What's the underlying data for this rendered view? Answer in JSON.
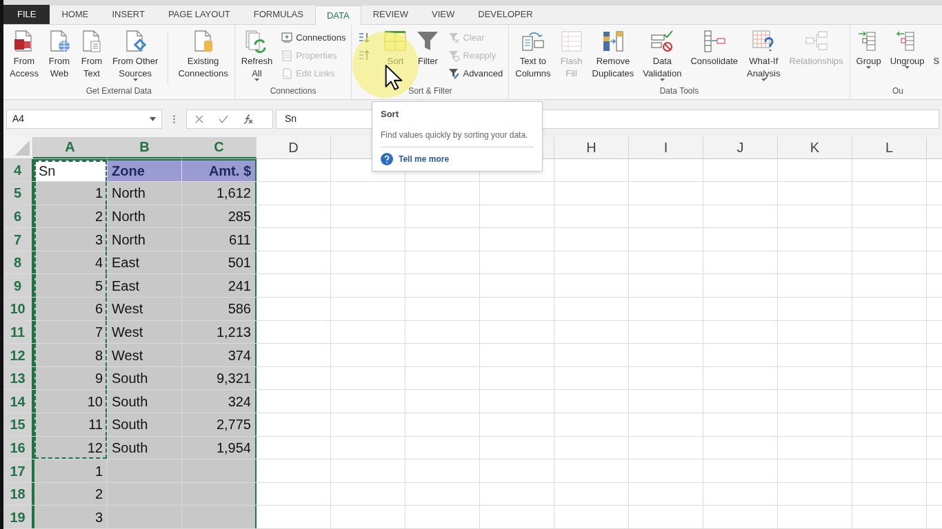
{
  "ribbon": {
    "tabs": [
      {
        "label": "FILE",
        "kind": "file",
        "selected": false
      },
      {
        "label": "HOME",
        "selected": false
      },
      {
        "label": "INSERT",
        "selected": false
      },
      {
        "label": "PAGE LAYOUT",
        "selected": false
      },
      {
        "label": "FORMULAS",
        "selected": false
      },
      {
        "label": "DATA",
        "selected": true
      },
      {
        "label": "REVIEW",
        "selected": false
      },
      {
        "label": "VIEW",
        "selected": false
      },
      {
        "label": "DEVELOPER",
        "selected": false
      }
    ],
    "groups": [
      {
        "label": "Get External Data",
        "items": [
          {
            "kind": "large",
            "label": "From\nAccess",
            "disabled": false,
            "dropdown": false
          },
          {
            "kind": "large",
            "label": "From\nWeb",
            "disabled": false,
            "dropdown": false
          },
          {
            "kind": "large",
            "label": "From\nText",
            "disabled": false,
            "dropdown": false
          },
          {
            "kind": "large",
            "label": "From Other\nSources",
            "disabled": false,
            "dropdown": true
          },
          {
            "kind": "divider"
          },
          {
            "kind": "large",
            "label": "Existing\nConnections",
            "disabled": false,
            "dropdown": false
          }
        ]
      },
      {
        "label": "Connections",
        "items": [
          {
            "kind": "large",
            "label": "Refresh\nAll",
            "disabled": false,
            "dropdown": true
          },
          {
            "kind": "stack",
            "entries": [
              {
                "label": "Connections",
                "disabled": false
              },
              {
                "label": "Properties",
                "disabled": true
              },
              {
                "label": "Edit Links",
                "disabled": true
              }
            ]
          }
        ]
      },
      {
        "label": "Sort & Filter",
        "items": [
          {
            "kind": "stack",
            "entries": [
              {
                "disabled": false
              },
              {
                "disabled": false
              }
            ]
          },
          {
            "kind": "large",
            "label": "Sort",
            "disabled": false,
            "dropdown": false
          },
          {
            "kind": "large",
            "label": "Filter",
            "disabled": false,
            "dropdown": false
          },
          {
            "kind": "stack",
            "entries": [
              {
                "label": "Clear",
                "disabled": true
              },
              {
                "label": "Reapply",
                "disabled": true
              },
              {
                "label": "Advanced",
                "disabled": false
              }
            ]
          }
        ]
      },
      {
        "label": "Data Tools",
        "items": [
          {
            "kind": "large",
            "label": "Text to\nColumns",
            "disabled": false,
            "dropdown": false
          },
          {
            "kind": "large",
            "label": "Flash\nFill",
            "disabled": true,
            "dropdown": false
          },
          {
            "kind": "large",
            "label": "Remove\nDuplicates",
            "disabled": false,
            "dropdown": false
          },
          {
            "kind": "large",
            "label": "Data\nValidation",
            "disabled": false,
            "dropdown": true
          },
          {
            "kind": "large",
            "label": "Consolidate",
            "disabled": false,
            "dropdown": false
          },
          {
            "kind": "large",
            "label": "What-If\nAnalysis",
            "disabled": false,
            "dropdown": true
          },
          {
            "kind": "large",
            "label": "Relationships",
            "disabled": true,
            "dropdown": false
          }
        ]
      },
      {
        "label": "Ou",
        "items": [
          {
            "kind": "large",
            "label": "Group",
            "disabled": false,
            "dropdown": true
          },
          {
            "kind": "large",
            "label": "Ungroup",
            "disabled": false,
            "dropdown": true
          },
          {
            "kind": "large",
            "label": "S",
            "disabled": false,
            "dropdown": false
          }
        ]
      }
    ]
  },
  "formula_bar": {
    "name_box": "A4",
    "content": "Sn"
  },
  "tooltip": {
    "title": "Sort",
    "description": "Find values quickly by sorting your data.",
    "link": "Tell me more"
  },
  "grid": {
    "columns": [
      {
        "label": "A",
        "selected": true
      },
      {
        "label": "B",
        "selected": true
      },
      {
        "label": "C",
        "selected": true
      },
      {
        "label": "D",
        "selected": false
      },
      {},
      {},
      {},
      {
        "label": "H",
        "selected": false
      },
      {
        "label": "I",
        "selected": false
      },
      {
        "label": "J",
        "selected": false
      },
      {
        "label": "K",
        "selected": false
      },
      {
        "label": "L",
        "selected": false
      }
    ],
    "rows": [
      {
        "number": "4",
        "kind": "header",
        "active": true,
        "copied": true,
        "cells": [
          "Sn",
          "Zone",
          "Amt. $"
        ]
      },
      {
        "number": "5",
        "active": false,
        "copied": true,
        "cells": [
          "1",
          "North",
          "1,612"
        ]
      },
      {
        "number": "6",
        "active": false,
        "copied": true,
        "cells": [
          "2",
          "North",
          "285"
        ]
      },
      {
        "number": "7",
        "active": false,
        "copied": true,
        "cells": [
          "3",
          "North",
          "611"
        ]
      },
      {
        "number": "8",
        "active": false,
        "copied": true,
        "cells": [
          "4",
          "East",
          "501"
        ]
      },
      {
        "number": "9",
        "active": false,
        "copied": true,
        "cells": [
          "5",
          "East",
          "241"
        ]
      },
      {
        "number": "10",
        "active": false,
        "copied": true,
        "cells": [
          "6",
          "West",
          "586"
        ]
      },
      {
        "number": "11",
        "active": false,
        "copied": true,
        "cells": [
          "7",
          "West",
          "1,213"
        ]
      },
      {
        "number": "12",
        "active": false,
        "copied": true,
        "cells": [
          "8",
          "West",
          "374"
        ]
      },
      {
        "number": "13",
        "active": false,
        "copied": true,
        "cells": [
          "9",
          "South",
          "9,321"
        ]
      },
      {
        "number": "14",
        "active": false,
        "copied": true,
        "cells": [
          "10",
          "South",
          "324"
        ]
      },
      {
        "number": "15",
        "active": false,
        "copied": true,
        "cells": [
          "11",
          "South",
          "2,775"
        ]
      },
      {
        "number": "16",
        "active": false,
        "copied": true,
        "cells": [
          "12",
          "South",
          "1,954"
        ]
      },
      {
        "number": "17",
        "active": false,
        "copied": false,
        "cells": [
          "1"
        ]
      },
      {
        "number": "18",
        "active": false,
        "copied": false,
        "cells": [
          "2"
        ]
      },
      {
        "number": "19",
        "active": false,
        "copied": false,
        "cells": [
          "3"
        ]
      }
    ]
  }
}
